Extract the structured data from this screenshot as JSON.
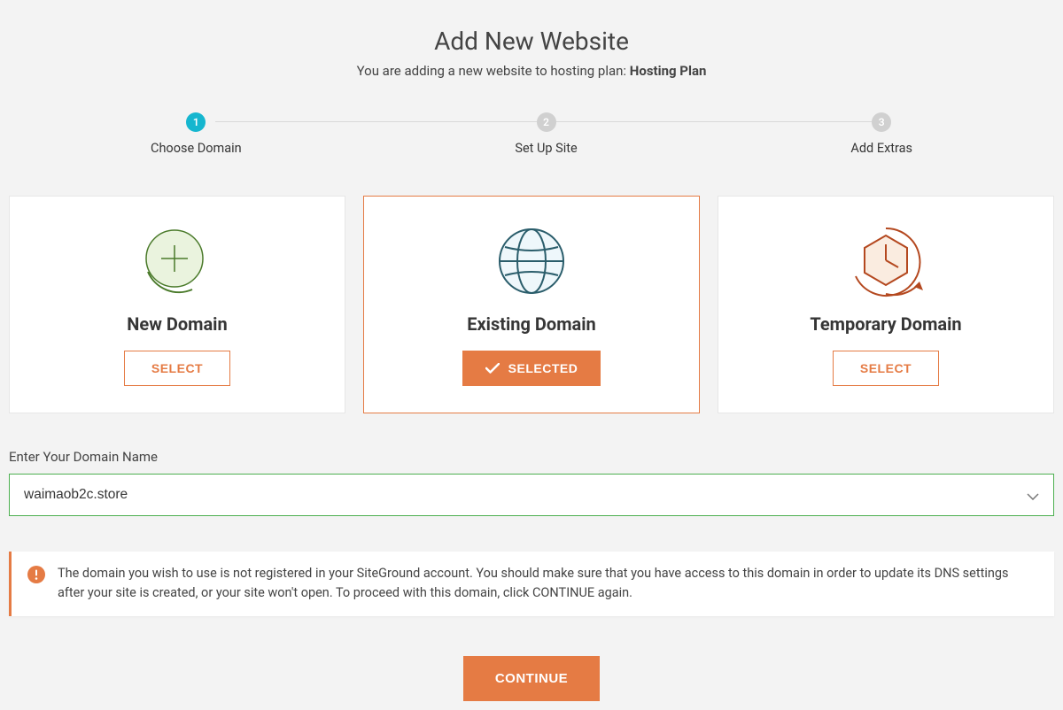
{
  "header": {
    "title": "Add New Website",
    "subtitle_prefix": "You are adding a new website to hosting plan: ",
    "plan_name": "Hosting Plan"
  },
  "stepper": {
    "steps": [
      {
        "number": "1",
        "label": "Choose Domain",
        "state": "active"
      },
      {
        "number": "2",
        "label": "Set Up Site",
        "state": "inactive"
      },
      {
        "number": "3",
        "label": "Add Extras",
        "state": "inactive"
      }
    ]
  },
  "cards": [
    {
      "title": "New Domain",
      "button_label": "SELECT",
      "selected": false
    },
    {
      "title": "Existing Domain",
      "button_label": "SELECTED",
      "selected": true
    },
    {
      "title": "Temporary Domain",
      "button_label": "SELECT",
      "selected": false
    }
  ],
  "domain_field": {
    "label": "Enter Your Domain Name",
    "value": "waimaob2c.store"
  },
  "alert": {
    "text": "The domain you wish to use is not registered in your SiteGround account. You should make sure that you have access to this domain in order to update its DNS settings after your site is created, or your site won't open. To proceed with this domain, click CONTINUE again."
  },
  "continue_label": "CONTINUE",
  "colors": {
    "accent": "#e57b44",
    "stepper_active": "#15b6cf",
    "success_border": "#4caf50"
  }
}
